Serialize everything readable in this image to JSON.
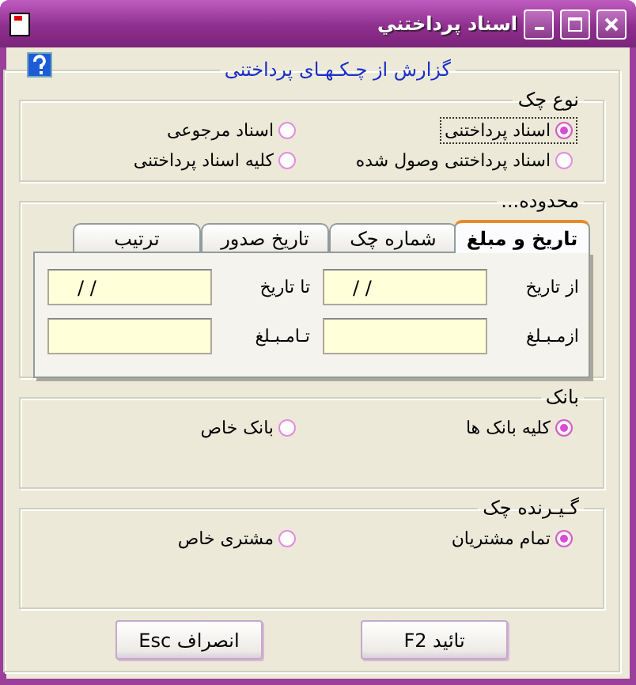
{
  "window": {
    "title": "اسناد پرداختني"
  },
  "report": {
    "title": "گزارش از چـکـهـای پرداختنی"
  },
  "check_type": {
    "title": "نوع چک",
    "options": [
      {
        "label": "اسناد پرداختنی",
        "selected": true,
        "focused": true
      },
      {
        "label": "اسناد مرجوعی",
        "selected": false,
        "focused": false
      },
      {
        "label": "اسناد پرداختنی وصول شده",
        "selected": false,
        "focused": false
      },
      {
        "label": "کلیه اسناد پرداختنی",
        "selected": false,
        "focused": false
      }
    ]
  },
  "range": {
    "title": "محدوده...",
    "tabs": [
      {
        "label": "تاریخ و مبلغ",
        "selected": true
      },
      {
        "label": "شماره چک",
        "selected": false
      },
      {
        "label": "تاریخ صدور",
        "selected": false
      },
      {
        "label": "ترتیب",
        "selected": false
      }
    ],
    "fields": [
      {
        "label": "از تاریخ",
        "value": "/ /"
      },
      {
        "label": "تا تاریخ",
        "value": "/ /"
      },
      {
        "label": "ازمـبـلغ"
      },
      {
        "label": "تـامـبـلغ"
      }
    ]
  },
  "bank": {
    "title": "بانک",
    "options": [
      {
        "label": "کلیه بانک ها",
        "selected": true
      },
      {
        "label": "بانک خاص",
        "selected": false
      }
    ]
  },
  "payee": {
    "title": "گـیـرنده چک",
    "options": [
      {
        "label": "تمام مشتریان",
        "selected": true
      },
      {
        "label": "مشتری خاص",
        "selected": false
      }
    ]
  },
  "buttons": [
    {
      "label": "تائید F2"
    },
    {
      "label": "انصراف Esc"
    }
  ]
}
